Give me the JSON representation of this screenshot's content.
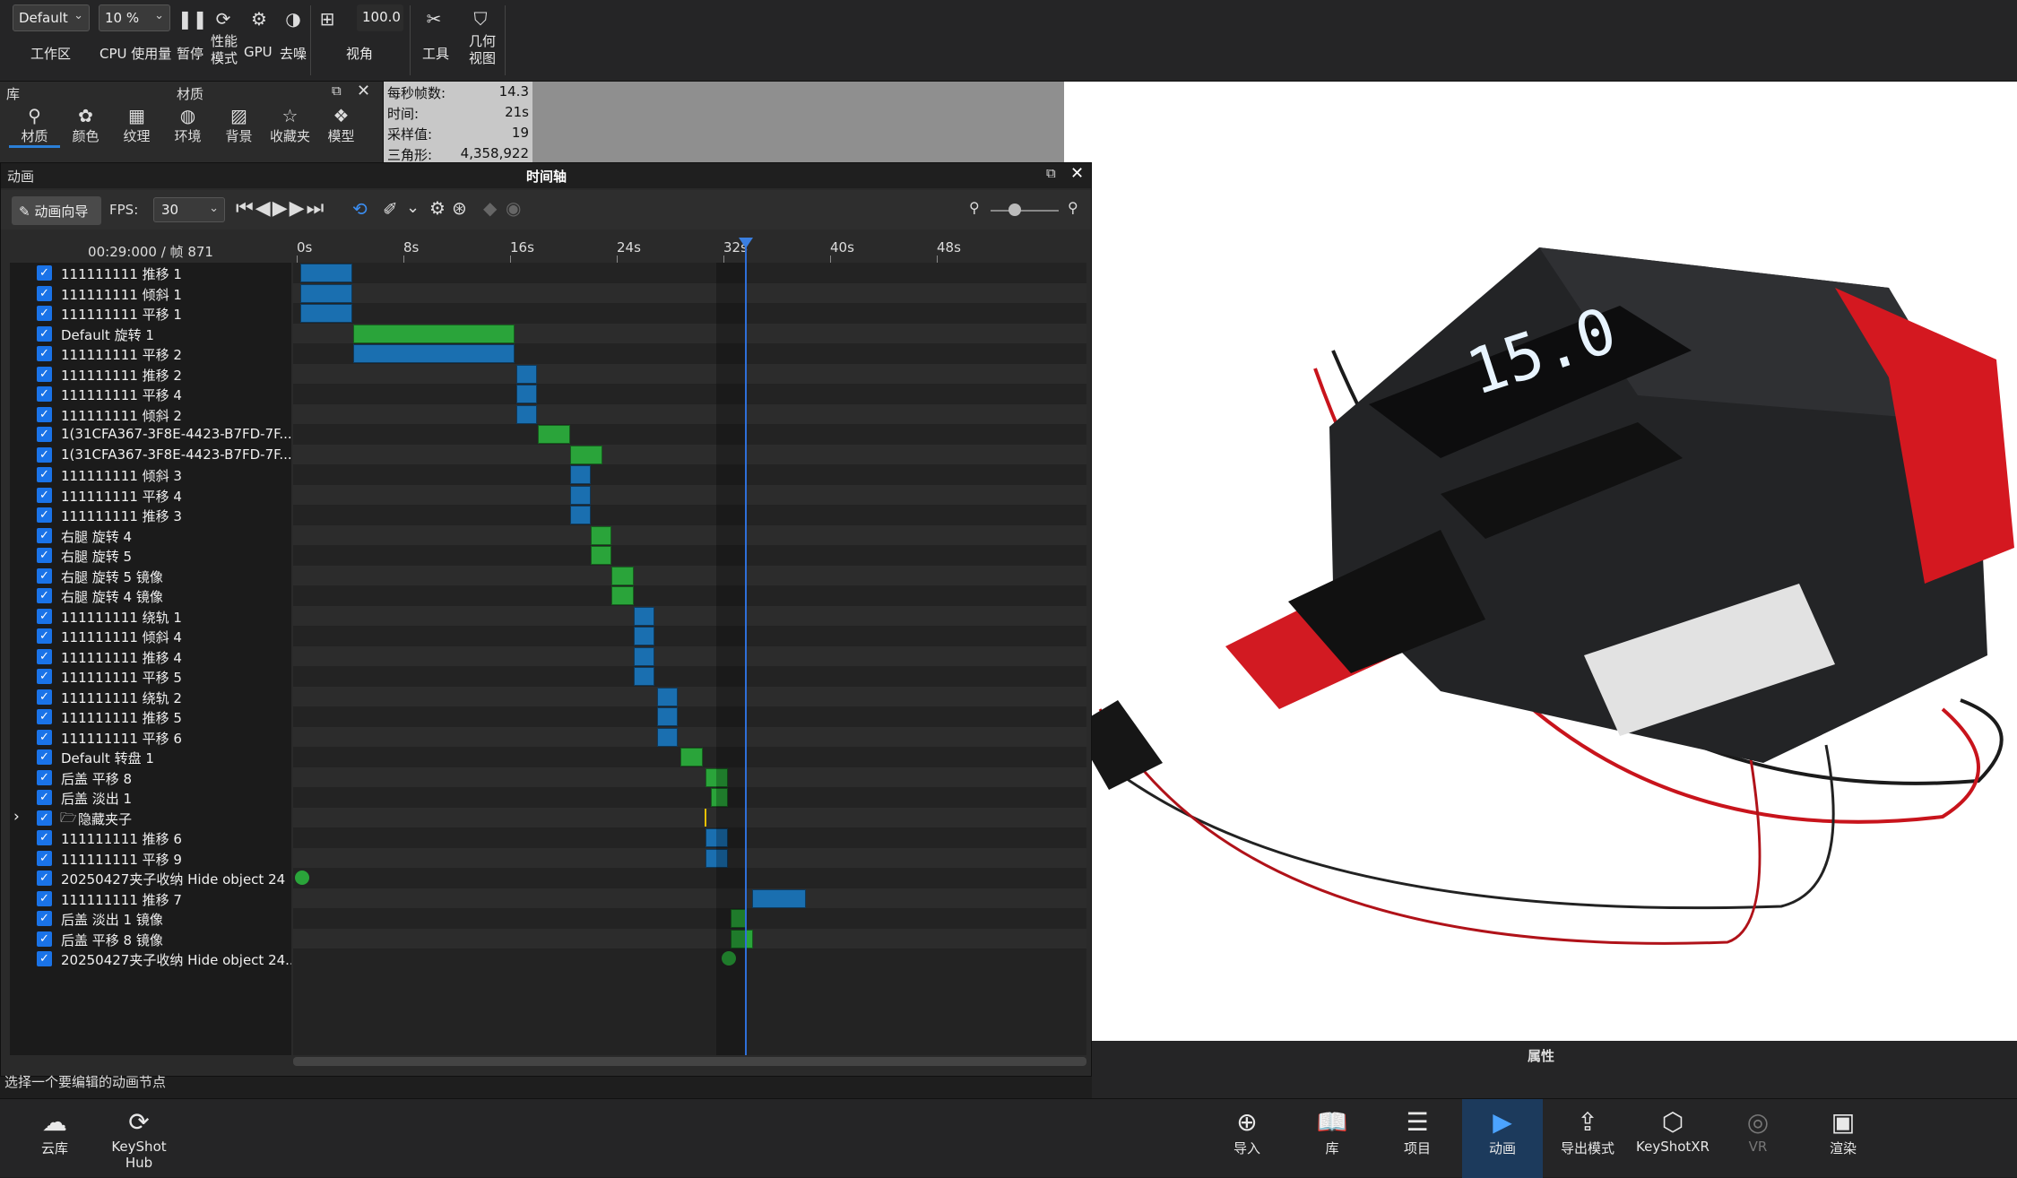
{
  "toolbar": {
    "workspace": "Default",
    "cpu_usage": "10 %",
    "quality": "100.0",
    "labels": {
      "workspace": "工作区",
      "cpu": "CPU 使用量",
      "pause": "暂停",
      "perf": "性能模式",
      "gpu": "GPU",
      "denoise": "去噪",
      "view": "视角",
      "tools": "工具",
      "geo": "几何视图"
    }
  },
  "library": {
    "title": "库",
    "subtitle": "材质",
    "tabs": [
      "材质",
      "颜色",
      "纹理",
      "环境",
      "背景",
      "收藏夹",
      "模型"
    ]
  },
  "stats": [
    {
      "label": "每秒帧数:",
      "value": "14.3"
    },
    {
      "label": "时间:",
      "value": "21s"
    },
    {
      "label": "采样值:",
      "value": "19"
    },
    {
      "label": "三角形:",
      "value": "4,358,922"
    }
  ],
  "animation": {
    "panel_title": "动画",
    "timeline_title": "时间轴",
    "wizard": "动画向导",
    "fps_label": "FPS:",
    "fps_value": "30",
    "time_readout": "00:29:000 / 帧 871",
    "ticks": [
      "0s",
      "8s",
      "16s",
      "24s",
      "32s",
      "40s",
      "48s"
    ],
    "tracks": [
      "111111111 推移 1",
      "111111111 倾斜 1",
      "111111111 平移 1",
      "Default 旋转 1",
      "111111111 平移 2",
      "111111111 推移 2",
      "111111111 平移 4",
      "111111111 倾斜 2",
      "1(31CFA367-3F8E-4423-B7FD-7F...",
      "1(31CFA367-3F8E-4423-B7FD-7F...",
      "111111111 倾斜 3",
      "111111111 平移 4",
      "111111111 推移 3",
      "右腿 旋转 4",
      "右腿 旋转 5",
      "右腿 旋转 5 镜像",
      "右腿 旋转 4 镜像",
      "111111111 绕轨 1",
      "111111111 倾斜 4",
      "111111111 推移 4",
      "111111111 平移 5",
      "111111111 绕轨 2",
      "111111111 推移 5",
      "111111111 平移 6",
      "Default 转盘 1",
      "后盖 平移 8",
      "后盖 淡出 1",
      "隐藏夹子",
      "111111111 推移 6",
      "111111111 平移 9",
      "20250427夹子收纳 Hide object 24",
      "111111111 推移 7",
      "后盖 淡出 1 镜像",
      "后盖 平移 8 镜像",
      "20250427夹子收纳 Hide object 24..."
    ],
    "status": "选择一个要编辑的动画节点"
  },
  "props_title": "属性",
  "bottom": [
    "云库",
    "KeyShot Hub",
    "导入",
    "库",
    "项目",
    "动画",
    "导出模式",
    "KeyShotXR",
    "VR",
    "渲染"
  ],
  "colors": {
    "accent": "#2b7fd6",
    "bar_blue": "#1a6fb0",
    "bar_green": "#2aa43a"
  }
}
